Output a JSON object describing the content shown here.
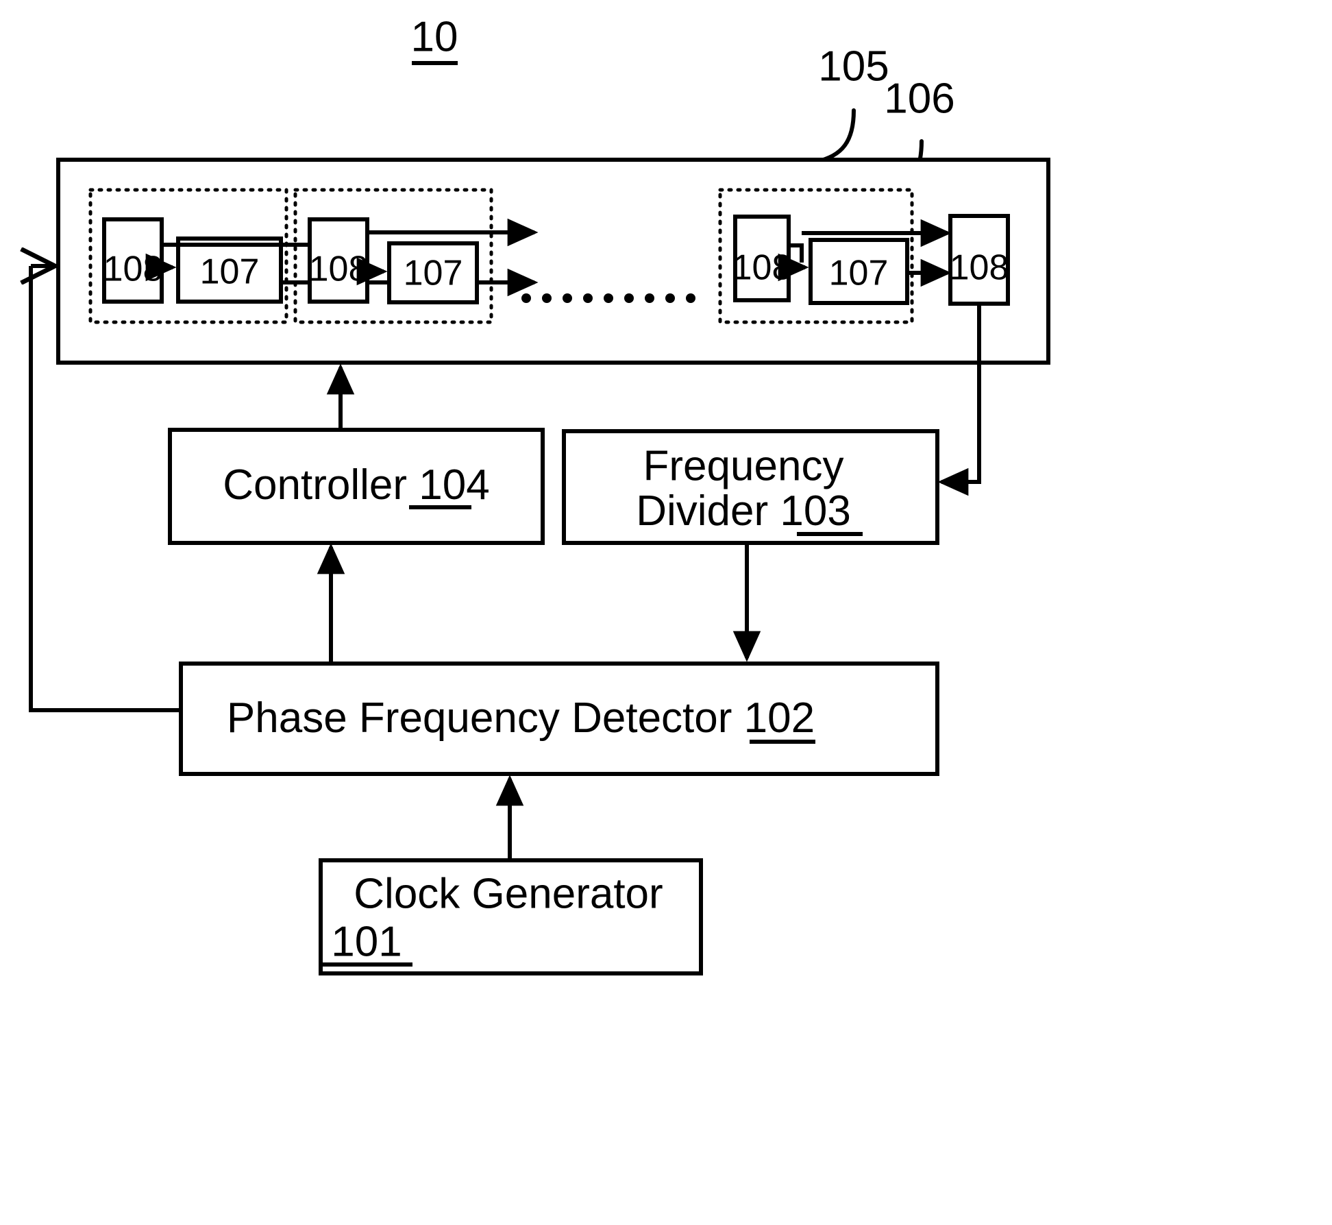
{
  "figure": {
    "title_number": "10",
    "callouts": [
      {
        "id": "callout-105",
        "label": "105"
      },
      {
        "id": "callout-106",
        "label": "106"
      }
    ]
  },
  "oscillator_block": {
    "name": "delay-line-outer-block",
    "reference": "105",
    "stage_group_reference": "106",
    "ellipsis": "...........",
    "stages": [
      {
        "name": "delay-stage-1",
        "phase_interpolator_label": "108",
        "delay_cell_label": "107"
      },
      {
        "name": "delay-stage-2",
        "phase_interpolator_label": "108",
        "delay_cell_label": "107"
      },
      {
        "name": "delay-stage-n",
        "phase_interpolator_label": "108",
        "delay_cell_label": "107"
      }
    ],
    "final_interpolator_label": "108"
  },
  "blocks": {
    "controller": {
      "name": "Controller",
      "text": "Controller",
      "ref": "104"
    },
    "frequency_divider": {
      "name": "Frequency Divider",
      "line1": "Frequency",
      "line2_text": "Divider",
      "ref": "103"
    },
    "phase_frequency_detector": {
      "name": "Phase Frequency Detector",
      "text": "Phase Frequency Detector",
      "ref": "102"
    },
    "clock_generator": {
      "name": "Clock Generator",
      "line1": "Clock Generator",
      "ref": "101"
    }
  },
  "colors": {
    "ink": "#000000",
    "paper": "#ffffff"
  }
}
